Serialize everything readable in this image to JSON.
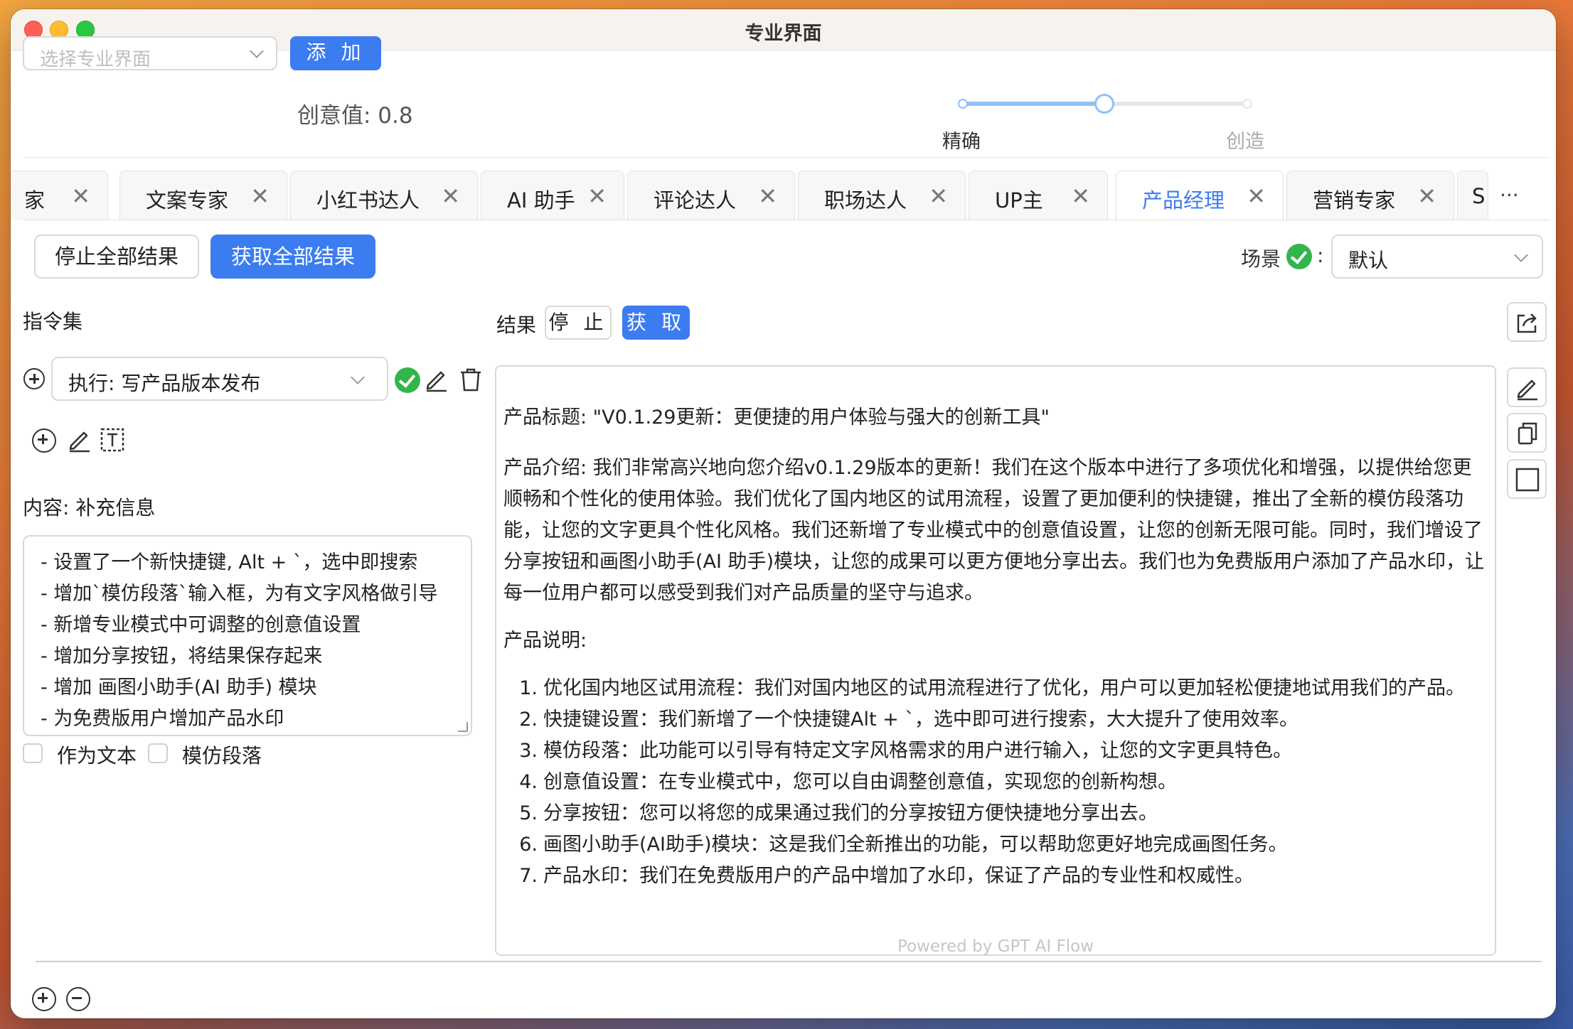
{
  "window": {
    "title": "专业界面"
  },
  "top": {
    "select_placeholder": "选择专业界面",
    "add_label": "添 加",
    "creative_value": "创意值: 0.8",
    "slider": {
      "value": 0.5,
      "left_label": "精确",
      "right_label": "创造"
    }
  },
  "tabs": [
    {
      "label": "家",
      "active": false
    },
    {
      "label": "文案专家",
      "active": false
    },
    {
      "label": "小红书达人",
      "active": false
    },
    {
      "label": "AI 助手",
      "active": false
    },
    {
      "label": "评论达人",
      "active": false
    },
    {
      "label": "职场达人",
      "active": false
    },
    {
      "label": "UP主",
      "active": false
    },
    {
      "label": "产品经理",
      "active": true
    },
    {
      "label": "营销专家",
      "active": false
    },
    {
      "label": "S",
      "active": false
    }
  ],
  "tab_close": "✕",
  "tab_more": "···",
  "actions": {
    "stop_all": "停止全部结果",
    "get_all": "获取全部结果",
    "scene_label": "场景",
    "scene_colon": ":",
    "scene_value": "默认"
  },
  "left": {
    "title": "指令集",
    "command_value": "执行: 写产品版本发布",
    "content_label": "内容: 补充信息",
    "textarea_lines": [
      "- 设置了一个新快捷键, Alt + `，选中即搜索",
      "- 增加`模仿段落`输入框，为有文字风格做引导",
      "- 新增专业模式中可调整的创意值设置",
      "- 增加分享按钮，将结果保存起来",
      "- 增加 画图小助手(AI 助手) 模块",
      "- 为免费版用户增加产品水印"
    ],
    "as_text_label": "作为文本",
    "imitate_label": "模仿段落"
  },
  "right": {
    "result_label": "结果",
    "stop_label": "停 止",
    "get_label": "获 取",
    "product_title": "产品标题: \"V0.1.29更新：更便捷的用户体验与强大的创新工具\"",
    "product_intro": "产品介绍: 我们非常高兴地向您介绍v0.1.29版本的更新！我们在这个版本中进行了多项优化和增强，以提供给您更顺畅和个性化的使用体验。我们优化了国内地区的试用流程，设置了更加便利的快捷键，推出了全新的模仿段落功能，让您的文字更具个性化风格。我们还新增了专业模式中的创意值设置，让您的创新无限可能。同时，我们增设了分享按钮和画图小助手(AI 助手)模块，让您的成果可以更方便地分享出去。我们也为免费版用户添加了产品水印，让每一位用户都可以感受到我们对产品质量的坚守与追求。",
    "product_desc_label": "产品说明:",
    "list": [
      {
        "num": "1.",
        "text": "优化国内地区试用流程：我们对国内地区的试用流程进行了优化，用户可以更加轻松便捷地试用我们的产品。"
      },
      {
        "num": "2.",
        "text": "快捷键设置：我们新增了一个快捷键Alt + `，选中即可进行搜索，大大提升了使用效率。"
      },
      {
        "num": "3.",
        "text": "模仿段落：此功能可以引导有特定文字风格需求的用户进行输入，让您的文字更具特色。"
      },
      {
        "num": "4.",
        "text": "创意值设置：在专业模式中，您可以自由调整创意值，实现您的创新构想。"
      },
      {
        "num": "5.",
        "text": "分享按钮：您可以将您的成果通过我们的分享按钮方便快捷地分享出去。"
      },
      {
        "num": "6.",
        "text": "画图小助手(AI助手)模块：这是我们全新推出的功能，可以帮助您更好地完成画图任务。"
      },
      {
        "num": "7.",
        "text": "产品水印：我们在免费版用户的产品中增加了水印，保证了产品的专业性和权威性。"
      }
    ],
    "powered_by": "Powered by GPT AI Flow"
  },
  "colors": {
    "accent": "#3b7cf0",
    "success": "#32b54b"
  },
  "icons": [
    "plus-circle-icon",
    "edit-icon",
    "trash-icon",
    "text-box-icon",
    "share-icon",
    "copy-icon",
    "square-icon",
    "check-circle-icon",
    "minus-circle-icon",
    "chevron-down-icon",
    "close-icon",
    "more-icon"
  ]
}
